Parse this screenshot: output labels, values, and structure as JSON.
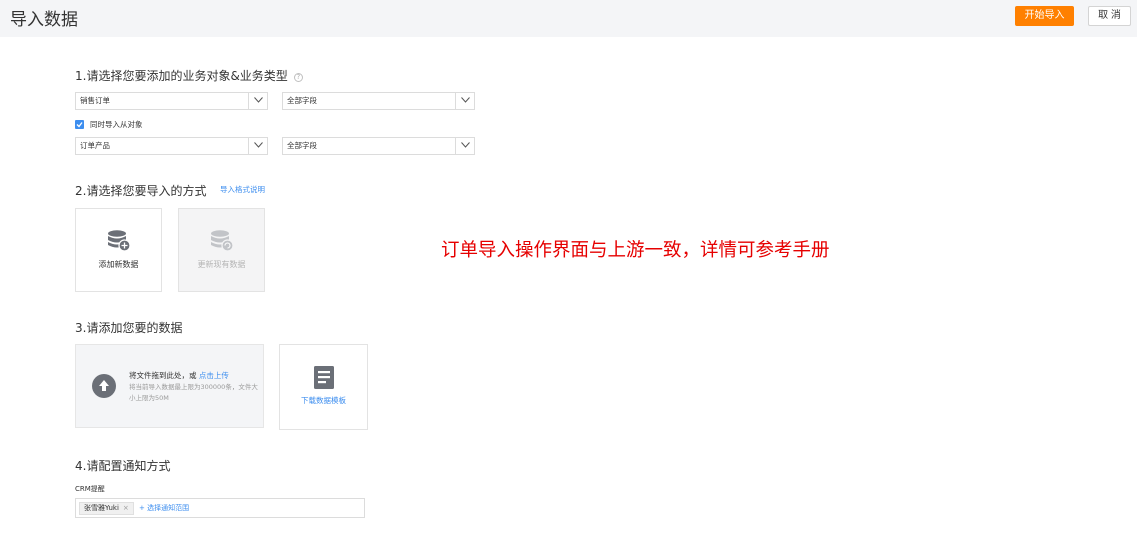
{
  "header": {
    "title": "导入数据",
    "start_button": "开始导入",
    "cancel_button": "取 消",
    "accent_color": "#ff8000"
  },
  "step1": {
    "title": "1.请选择您要添加的业务对象&业务类型",
    "help_icon": "question-circle-icon",
    "object_select": "销售订单",
    "type_select": "全部字段",
    "import_child_checked": true,
    "import_child_label": "同时导入从对象",
    "child_object_select": "订单产品",
    "child_type_select": "全部字段"
  },
  "step2": {
    "title": "2.请选择您要导入的方式",
    "format_link": "导入格式说明",
    "modes": [
      {
        "label": "添加新数据",
        "icon": "database-add-icon",
        "enabled": true
      },
      {
        "label": "更新现有数据",
        "icon": "database-update-icon",
        "enabled": false
      }
    ]
  },
  "step3": {
    "title": "3.请添加您要的数据",
    "upload_text": "将文件拖到此处，或",
    "upload_link": "点击上传",
    "upload_hint": "将当前导入数据最上限为300000条，文件大小上限为50M",
    "template_label": "下载数据模板"
  },
  "step4": {
    "title": "4.请配置通知方式",
    "crm_label": "CRM提醒",
    "recipients": [
      {
        "name": "张雪雅Yuki"
      }
    ],
    "add_scope": "+ 选择通知范围"
  },
  "annotation": "订单导入操作界面与上游一致，详情可参考手册"
}
